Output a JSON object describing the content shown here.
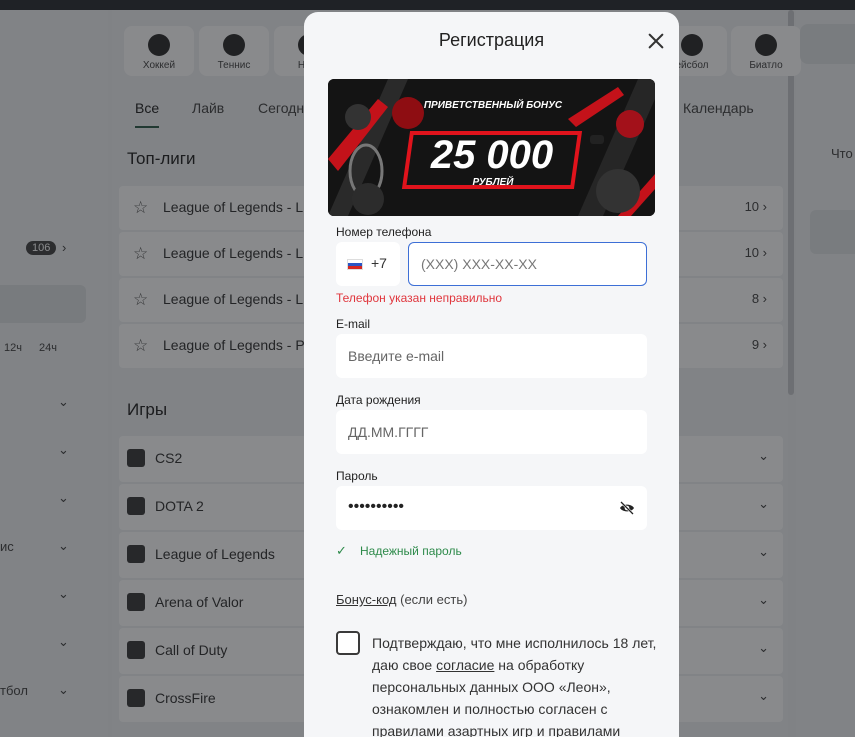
{
  "background": {
    "sport_tabs": [
      "Хоккей",
      "Теннис",
      "Наст",
      "ейсбол",
      "Биатло"
    ],
    "filters": [
      "Все",
      "Лайв",
      "Сегодн",
      "Календарь"
    ],
    "top_leagues_heading": "Топ-лиги",
    "top_leagues": [
      {
        "name": "League of Legends - L",
        "count": "10"
      },
      {
        "name": "League of Legends - L",
        "count": "10"
      },
      {
        "name": "League of Legends - L",
        "count": "8"
      },
      {
        "name": "League of Legends - P",
        "count": "9"
      }
    ],
    "games_heading": "Игры",
    "games": [
      "CS2",
      "DOTA 2",
      "League of Legends",
      "Arena of Valor",
      "Call of Duty",
      "CrossFire"
    ],
    "left": {
      "badge": "106",
      "time_12": "12ч",
      "time_24": "24ч",
      "sport_a": "ис",
      "sport_b": "тбол"
    },
    "right_partial": "Что"
  },
  "modal": {
    "title": "Регистрация",
    "banner": {
      "top": "ПРИВЕТСТВЕННЫЙ БОНУС",
      "amount": "25 000",
      "sub": "РУБЛЕЙ"
    },
    "phone": {
      "label": "Номер телефона",
      "code": "+7",
      "placeholder": "(XXX) XXX-XX-XX",
      "error": "Телефон указан неправильно"
    },
    "email": {
      "label": "E-mail",
      "placeholder": "Введите e-mail"
    },
    "birth": {
      "label": "Дата рождения",
      "placeholder": "ДД.ММ.ГГГГ"
    },
    "password": {
      "label": "Пароль",
      "value": "••••••••••",
      "strength": "Надежный пароль"
    },
    "promo": {
      "link": "Бонус-код",
      "suffix": " (если есть)"
    },
    "agreement": {
      "p1": "Подтверждаю, что мне исполнилось 18 лет, даю свое ",
      "link1": "согласие",
      "p2": " на обработку персональных данных ООО «Леон», ознакомлен и полностью согласен с ",
      "link2": "правилами",
      "p3": " азартных игр и правилами"
    }
  }
}
